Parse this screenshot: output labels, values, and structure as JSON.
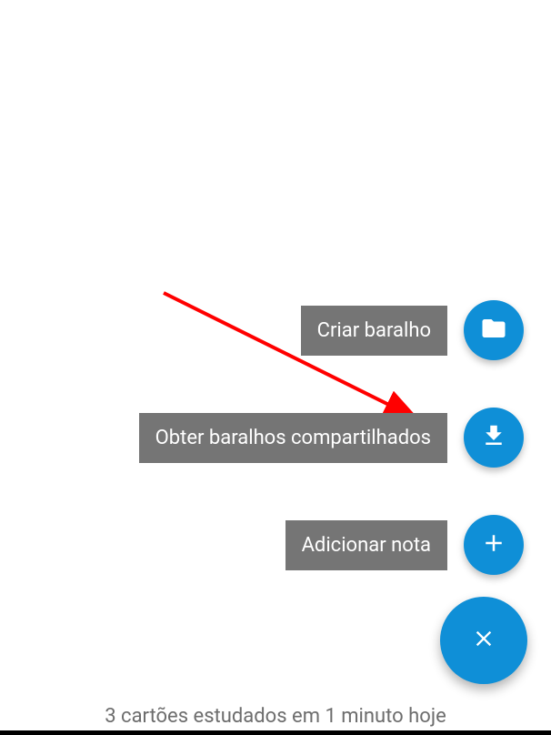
{
  "fab": {
    "actions": [
      {
        "label": "Criar baralho"
      },
      {
        "label": "Obter baralhos compartilhados"
      },
      {
        "label": "Adicionar nota"
      }
    ]
  },
  "status": {
    "text": "3 cartões estudados em 1 minuto hoje"
  },
  "colors": {
    "accent": "#0f8fd7",
    "label_bg": "#757575",
    "arrow": "#ff0000"
  }
}
